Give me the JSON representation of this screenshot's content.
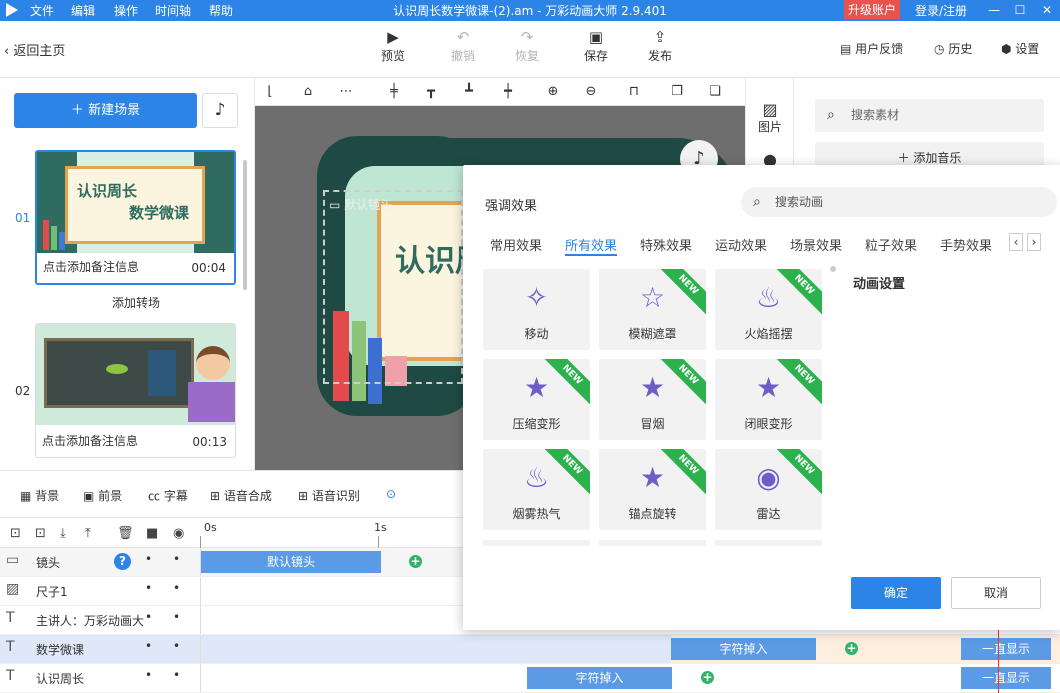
{
  "titlebar": {
    "menus": [
      "文件",
      "编辑",
      "操作",
      "时间轴",
      "帮助"
    ],
    "title": "认识周长数学微课-(2).am - 万彩动画大师 2.9.401",
    "upgrade": "升级账户",
    "login": "登录/注册"
  },
  "toolbar": {
    "back": "返回主页",
    "preview": "预览",
    "undo": "撤销",
    "redo": "恢复",
    "save": "保存",
    "publish": "发布",
    "feedback": "用户反馈",
    "history": "历史",
    "settings": "设置"
  },
  "left": {
    "new_scene": "新建场景",
    "add_transition": "添加转场",
    "scenes": [
      {
        "num": "01",
        "note": "点击添加备注信息",
        "dur": "00:04",
        "thumb_text_1": "认识周长",
        "thumb_text_2": "数学微课"
      },
      {
        "num": "02",
        "note": "点击添加备注信息",
        "dur": "00:13"
      }
    ]
  },
  "canvas": {
    "camera_label": "默认镜头",
    "headline": "认识周"
  },
  "rightstrip": {
    "image": "图片"
  },
  "rightpanel": {
    "search_placeholder": "搜索素材",
    "add_music": "添加音乐"
  },
  "timeline": {
    "tools": [
      "背景",
      "前景",
      "字幕",
      "语音合成",
      "语音识别"
    ],
    "ruler": [
      "0s",
      "1s"
    ],
    "tracks": [
      {
        "label": "镜头",
        "clip": "默认镜头"
      },
      {
        "label": "尺子1"
      },
      {
        "label": "主讲人：万彩动画大"
      },
      {
        "label": "数学微课",
        "clip": "字符掉入",
        "clip2": "一直显示"
      },
      {
        "label": "认识周长",
        "clip": "字符掉入",
        "clip2": "一直显示"
      }
    ]
  },
  "popup": {
    "title": "强调效果",
    "search_placeholder": "搜索动画",
    "tabs": [
      "常用效果",
      "所有效果",
      "特殊效果",
      "运动效果",
      "场景效果",
      "粒子效果",
      "手势效果"
    ],
    "active_tab": "所有效果",
    "settings_title": "动画设置",
    "tiles": [
      {
        "label": "移动",
        "icon": "✧",
        "new": false
      },
      {
        "label": "模糊遮罩",
        "icon": "☆",
        "new": true
      },
      {
        "label": "火焰摇摆",
        "icon": "♨",
        "new": true
      },
      {
        "label": "压缩变形",
        "icon": "★",
        "new": true
      },
      {
        "label": "冒烟",
        "icon": "★",
        "new": true
      },
      {
        "label": "闭眼变形",
        "icon": "★",
        "new": true
      },
      {
        "label": "烟雾热气",
        "icon": "♨",
        "new": true
      },
      {
        "label": "锚点旋转",
        "icon": "★",
        "new": true
      },
      {
        "label": "雷达",
        "icon": "◉",
        "new": true
      }
    ],
    "new_badge": "NEW",
    "ok": "确定",
    "cancel": "取消"
  },
  "colors": {
    "accent": "#2b84e6",
    "badge": "#2bb24c",
    "upgrade": "#e8544c"
  }
}
